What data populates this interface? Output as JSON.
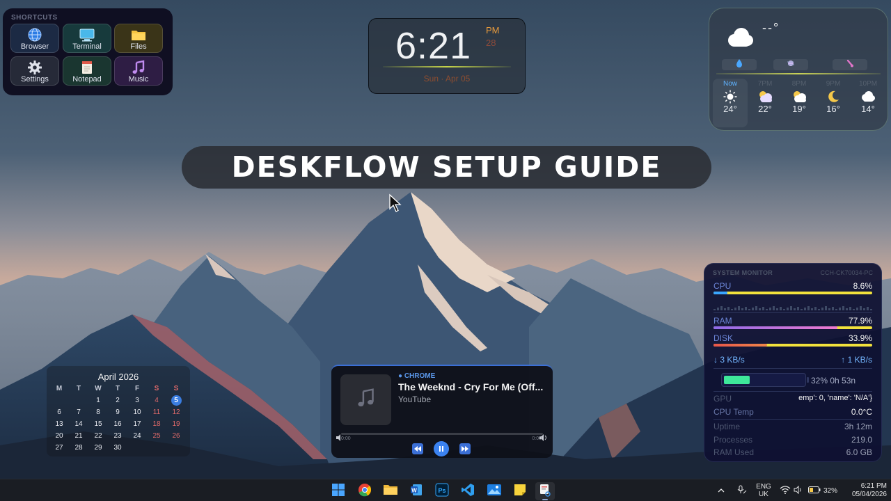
{
  "shortcuts": {
    "title": "SHORTCUTS",
    "items": [
      {
        "label": "Browser",
        "icon": "globe-icon"
      },
      {
        "label": "Terminal",
        "icon": "monitor-icon"
      },
      {
        "label": "Files",
        "icon": "folder-icon"
      },
      {
        "label": "Settings",
        "icon": "gear-icon"
      },
      {
        "label": "Notepad",
        "icon": "notepad-icon"
      },
      {
        "label": "Music",
        "icon": "music-note-icon"
      }
    ]
  },
  "clock": {
    "time": "6:21",
    "ampm": "PM",
    "seconds": "28",
    "date": "Sun · Apr 05",
    "accent": "#e79a3c"
  },
  "weather": {
    "current_temp": "--°",
    "current_icon": "cloud-icon",
    "stats_icons": [
      "droplet-icon",
      "wind-icon",
      "thermometer-icon"
    ],
    "forecast": [
      {
        "label": "Now",
        "temp": "24°",
        "icon": "sun-icon"
      },
      {
        "label": "7PM",
        "temp": "22°",
        "icon": "partly-cloudy-icon"
      },
      {
        "label": "8PM",
        "temp": "19°",
        "icon": "partly-cloudy-icon"
      },
      {
        "label": "9PM",
        "temp": "16°",
        "icon": "moon-icon"
      },
      {
        "label": "10PM",
        "temp": "14°",
        "icon": "cloud-icon"
      }
    ]
  },
  "banner": {
    "title": "DESKFLOW SETUP GUIDE"
  },
  "calendar": {
    "month": "April 2026",
    "weekdays": [
      "M",
      "T",
      "W",
      "T",
      "F",
      "S",
      "S"
    ],
    "today": "5",
    "weeks": [
      [
        "",
        "",
        "1",
        "2",
        "3",
        "4",
        "5"
      ],
      [
        "6",
        "7",
        "8",
        "9",
        "10",
        "11",
        "12"
      ],
      [
        "13",
        "14",
        "15",
        "16",
        "17",
        "18",
        "19"
      ],
      [
        "20",
        "21",
        "22",
        "23",
        "24",
        "25",
        "26"
      ],
      [
        "27",
        "28",
        "29",
        "30",
        "",
        "",
        ""
      ]
    ]
  },
  "media": {
    "source": "CHROME",
    "title": "The Weeknd - Cry For Me (Off...",
    "artist": "YouTube",
    "elapsed": "0:00",
    "duration": "0:00",
    "progress": 0,
    "accent": "#3b6fd6"
  },
  "sysmon": {
    "title": "SYSTEM MONITOR",
    "host": "CCH-CK70034-PC",
    "cpu": {
      "label": "CPU",
      "value": "8.6%",
      "fraction": 0.086
    },
    "ram": {
      "label": "RAM",
      "value": "77.9%",
      "fraction": 0.779
    },
    "disk": {
      "label": "DISK",
      "value": "33.9%",
      "fraction": 0.339
    },
    "net_down": "3 KB/s",
    "net_up": "1 KB/s",
    "battery": {
      "text": "32%  0h 53n",
      "fraction": 0.32
    },
    "gpu": {
      "label": "GPU",
      "value": "emp': 0, 'name': 'N/A'}"
    },
    "cpu_temp": {
      "label": "CPU Temp",
      "value": "0.0°C"
    },
    "uptime": {
      "label": "Uptime",
      "value": "3h 12m"
    },
    "processes": {
      "label": "Processes",
      "value": "219.0"
    },
    "ram_used": {
      "label": "RAM Used",
      "value": "6.0 GB"
    }
  },
  "taskbar": {
    "apps": [
      "windows-start-icon",
      "chrome-icon",
      "file-explorer-icon",
      "word-icon",
      "photoshop-icon",
      "vscode-icon",
      "photos-icon",
      "sticky-notes-icon",
      "snipping-tool-icon"
    ],
    "lang_top": "ENG",
    "lang_bottom": "UK",
    "battery": "32%",
    "time": "6:21 PM",
    "date": "05/04/2026"
  }
}
